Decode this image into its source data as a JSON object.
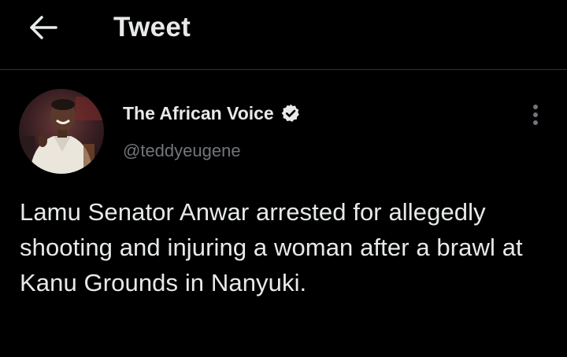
{
  "header": {
    "back_icon": "arrow-left-icon",
    "title": "Tweet"
  },
  "tweet": {
    "author": {
      "name": "The African Voice",
      "handle": "@teddyeugene",
      "verified_icon": "verified-badge-icon"
    },
    "more_icon": "more-vertical-icon",
    "text": "Lamu Senator Anwar arrested for allegedly shooting and injuring a woman after a brawl at Kanu Grounds in Nanyuki."
  },
  "colors": {
    "background": "#000000",
    "primary_text": "#e7e9ea",
    "secondary_text": "#71767b",
    "divider": "#2f3336"
  }
}
